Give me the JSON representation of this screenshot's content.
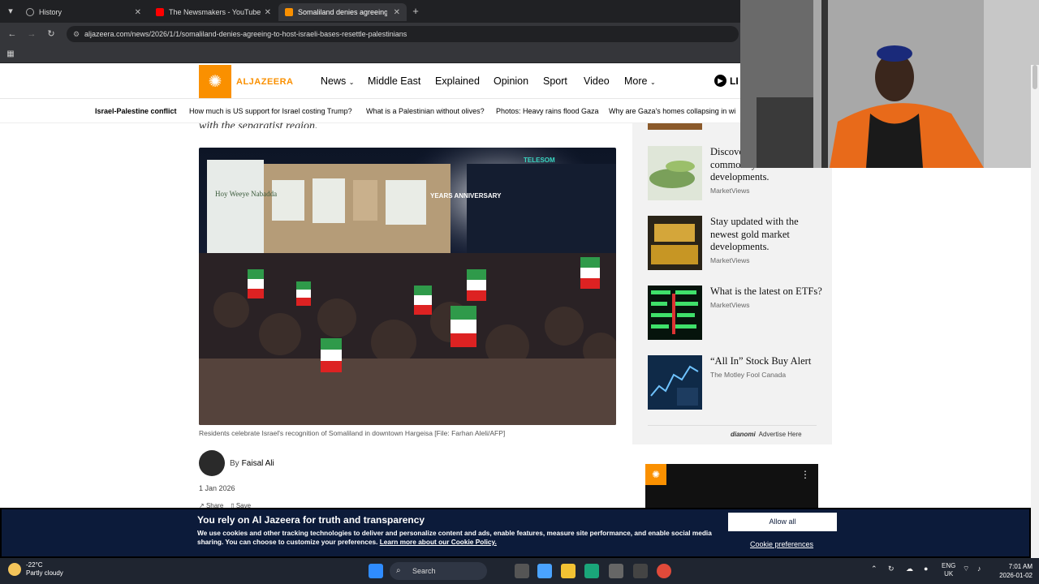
{
  "browser": {
    "tabs": [
      {
        "label": "History",
        "active": false
      },
      {
        "label": "The Newsmakers - YouTube",
        "active": false
      },
      {
        "label": "Somaliland denies agreeing to",
        "active": true
      }
    ],
    "url": "aljazeera.com/news/2026/1/1/somaliland-denies-agreeing-to-host-israeli-bases-resettle-palestinians"
  },
  "site": {
    "logo_text": "ALJAZEERA",
    "nav": [
      "News",
      "Middle East",
      "Explained",
      "Opinion",
      "Sport",
      "Video",
      "More"
    ],
    "live_label": "LI",
    "trending": [
      "Israel-Palestine conflict",
      "How much is US support for Israel costing Trump?",
      "What is a Palestinian without olives?",
      "Photos: Heavy rains flood Gaza",
      "Why are Gaza's homes collapsing in wi"
    ]
  },
  "article": {
    "subtitle_fragment": "with the separatist region.",
    "photo_text": {
      "banner": "Hoy Weeye Nabadda",
      "years": "YEARS ANNIVERSARY",
      "telesom": "TELESOM"
    },
    "caption": "Residents celebrate Israel's recognition of Somaliland in downtown Hargeisa [File: Farhan Aleli/AFP]",
    "author_prefix": "By",
    "author_name": "Faisal Ali",
    "date": "1 Jan 2026",
    "share_label": "Share",
    "save_label": "Save"
  },
  "sidebar": {
    "recommendations": [
      {
        "title": "Discover the latest commodity market developments.",
        "source": "MarketViews"
      },
      {
        "title": "Stay updated with the newest gold market developments.",
        "source": "MarketViews"
      },
      {
        "title": "What is the latest on ETFs?",
        "source": "MarketViews"
      },
      {
        "title": "“All In” Stock Buy Alert",
        "source": "The Motley Fool Canada"
      }
    ],
    "dianomi": "dianomi",
    "advertise": "Advertise Here"
  },
  "cookie": {
    "title": "You rely on Al Jazeera for truth and transparency",
    "text": "We use cookies and other tracking technologies to deliver and personalize content and ads, enable features, measure site performance, and enable social media sharing. You can choose to customize your preferences.",
    "link": "Learn more about our Cookie Policy.",
    "allow_all": "Allow all",
    "preferences": "Cookie preferences"
  },
  "taskbar": {
    "temperature": "-22°C",
    "weather": "Partly cloudy",
    "search": "Search",
    "lang": "ENG",
    "region": "UK",
    "time": "7:01 AM",
    "date": "2026-01-02"
  },
  "colors": {
    "brand": "#fa9000",
    "cookie_bg": "#0c1b3a"
  }
}
